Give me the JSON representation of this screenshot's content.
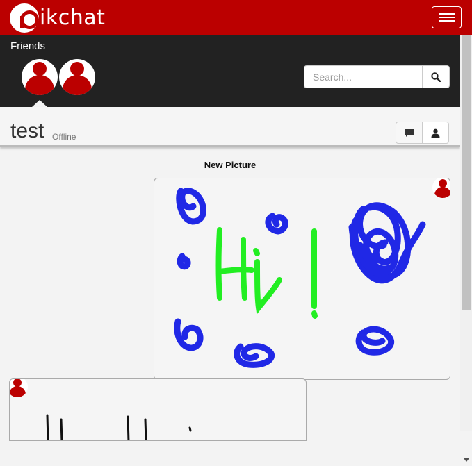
{
  "brand": {
    "name": "ikchat",
    "logo_letter": "P",
    "accent": "#bb0000"
  },
  "navbar": {
    "menu_icon": "hamburger-icon"
  },
  "friends": {
    "label": "Friends",
    "items": [
      {
        "avatar_icon": "user-avatar-icon",
        "selected": true
      },
      {
        "avatar_icon": "user-avatar-icon",
        "selected": false
      }
    ]
  },
  "search": {
    "placeholder": "Search...",
    "value": "",
    "icon": "search-icon"
  },
  "chat": {
    "title": "test",
    "status": "Offline",
    "buttons": [
      {
        "name": "message",
        "icon": "chat-bubble-icon"
      },
      {
        "name": "profile",
        "icon": "user-icon"
      }
    ]
  },
  "messages": [
    {
      "caption": "New Picture",
      "side": "right",
      "drawing": "Hi !"
    },
    {
      "caption": "",
      "side": "left",
      "drawing": ""
    }
  ],
  "colors": {
    "drawing_blue": "#2028e6",
    "drawing_green": "#22ee22",
    "dark_bar": "#222222"
  }
}
